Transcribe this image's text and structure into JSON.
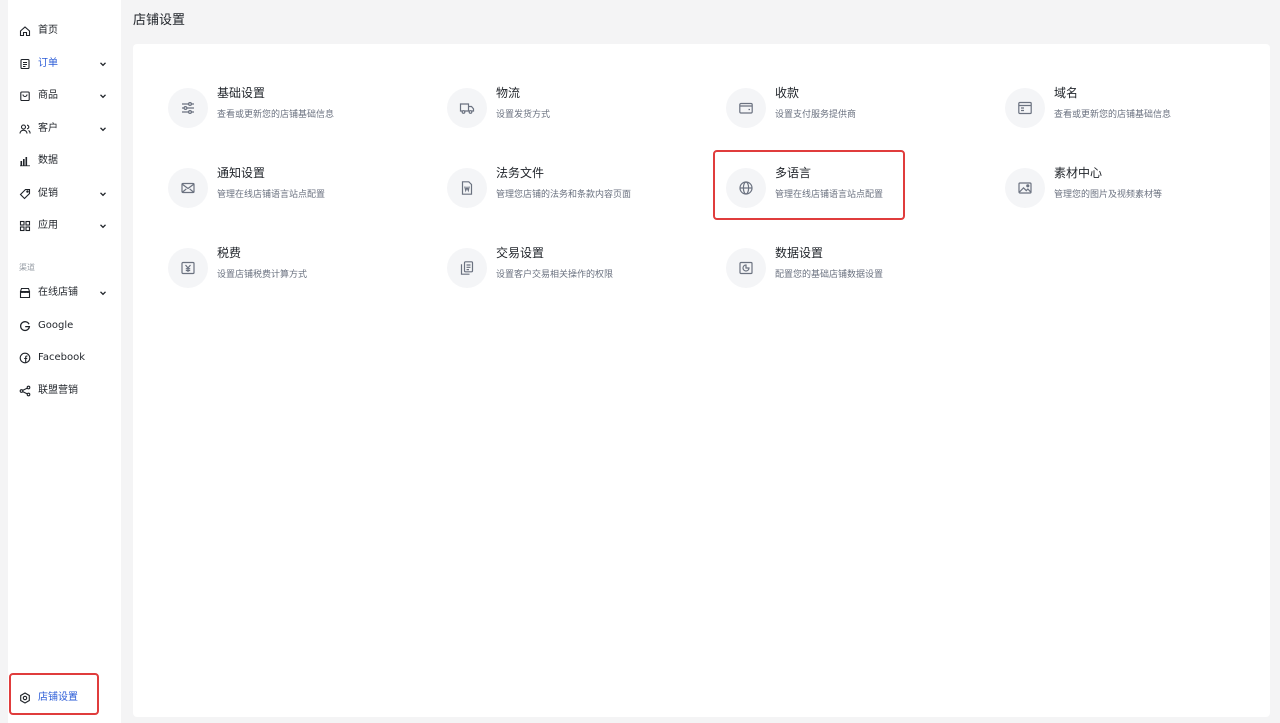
{
  "page_title": "店铺设置",
  "sidebar": {
    "items": [
      {
        "label": "首页",
        "icon": "home-icon"
      },
      {
        "label": "订单",
        "icon": "order-icon",
        "active": true
      },
      {
        "label": "商品",
        "icon": "product-icon"
      },
      {
        "label": "客户",
        "icon": "customer-icon"
      },
      {
        "label": "数据",
        "icon": "chart-icon"
      },
      {
        "label": "促销",
        "icon": "tag-icon"
      },
      {
        "label": "应用",
        "icon": "apps-icon"
      }
    ],
    "section_label": "渠道",
    "channels": [
      {
        "label": "在线店铺",
        "icon": "store-icon"
      },
      {
        "label": "Google",
        "icon": "google-icon"
      },
      {
        "label": "Facebook",
        "icon": "facebook-icon"
      },
      {
        "label": "联盟营销",
        "icon": "share-icon"
      }
    ],
    "footer": {
      "label": "店铺设置",
      "icon": "gear-icon"
    }
  },
  "settings": [
    {
      "title": "基础设置",
      "desc": "查看或更新您的店铺基础信息",
      "icon": "sliders-icon"
    },
    {
      "title": "物流",
      "desc": "设置发货方式",
      "icon": "truck-icon"
    },
    {
      "title": "收款",
      "desc": "设置支付服务提供商",
      "icon": "wallet-icon"
    },
    {
      "title": "域名",
      "desc": "查看或更新您的店铺基础信息",
      "icon": "browser-icon"
    },
    {
      "title": "通知设置",
      "desc": "管理在线店铺语言站点配置",
      "icon": "mail-icon"
    },
    {
      "title": "法务文件",
      "desc": "管理您店铺的法务和条款内容页面",
      "icon": "document-icon"
    },
    {
      "title": "多语言",
      "desc": "管理在线店铺语言站点配置",
      "icon": "globe-icon"
    },
    {
      "title": "素材中心",
      "desc": "管理您的图片及视频素材等",
      "icon": "image-icon"
    },
    {
      "title": "税费",
      "desc": "设置店铺税费计算方式",
      "icon": "yen-icon"
    },
    {
      "title": "交易设置",
      "desc": "设置客户交易相关操作的权限",
      "icon": "copy-icon"
    },
    {
      "title": "数据设置",
      "desc": "配置您的基础店铺数据设置",
      "icon": "data-icon"
    }
  ]
}
